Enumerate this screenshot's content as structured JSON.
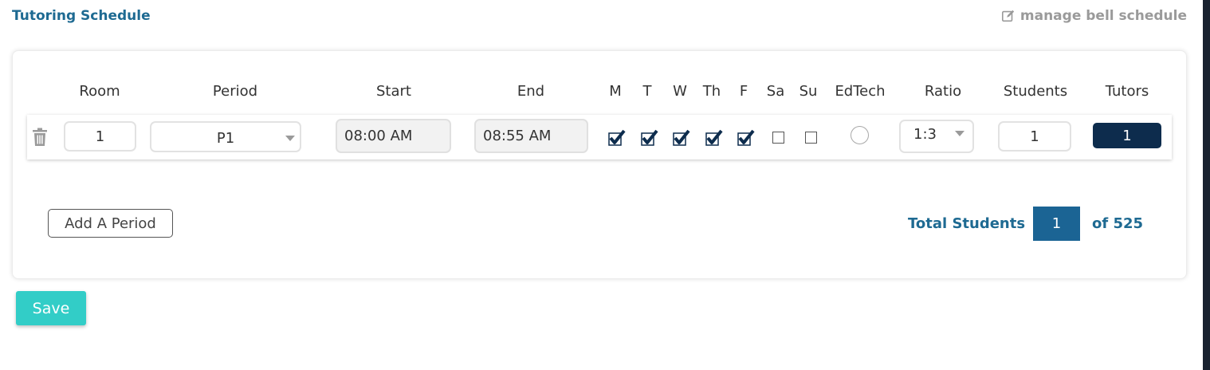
{
  "header": {
    "title": "Tutoring Schedule",
    "manage_link": "manage bell schedule"
  },
  "table": {
    "columns": {
      "room": "Room",
      "period": "Period",
      "start": "Start",
      "end": "End",
      "m": "M",
      "t": "T",
      "w": "W",
      "th": "Th",
      "f": "F",
      "sa": "Sa",
      "su": "Su",
      "edtech": "EdTech",
      "ratio": "Ratio",
      "students": "Students",
      "tutors": "Tutors"
    },
    "rows": [
      {
        "room": "1",
        "period": "P1",
        "start": "08:00 AM",
        "end": "08:55 AM",
        "days": {
          "m": true,
          "t": true,
          "w": true,
          "th": true,
          "f": true,
          "sa": false,
          "su": false
        },
        "edtech": false,
        "ratio": "1:3",
        "students": "1",
        "tutors": "1"
      }
    ]
  },
  "actions": {
    "add_period": "Add A Period",
    "save": "Save"
  },
  "totals": {
    "label": "Total Students",
    "value": "1",
    "of": "of 525"
  },
  "colors": {
    "brand_blue": "#1e6a92",
    "navy": "#0d2c4d",
    "teal": "#32cdc7"
  },
  "icons": [
    "edit-icon",
    "trash-icon",
    "checkmark-icon",
    "caret-down-icon"
  ]
}
